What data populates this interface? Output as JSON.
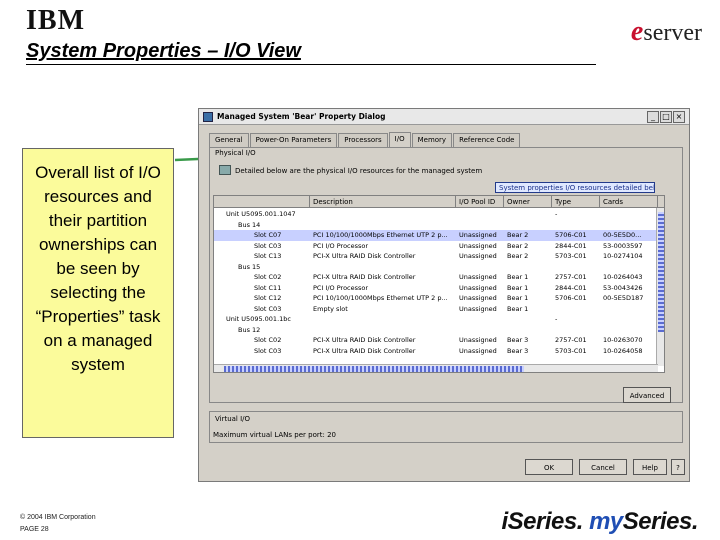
{
  "header": {
    "logo_text": "IBM",
    "brand_e": "e",
    "brand_rest": "server",
    "slide_title": "System Properties – I/O View"
  },
  "callout": {
    "text": "Overall list of I/O resources and their partition ownerships can be seen by selecting the “Properties” task on a managed system"
  },
  "dialog": {
    "title": "Managed System 'Bear' Property Dialog",
    "tabs": [
      "General",
      "Power-On Parameters",
      "Processors",
      "I/O",
      "Memory",
      "Reference Code"
    ],
    "active_tab": "I/O",
    "physical_io_label": "Physical I/O",
    "description": "Detailed below are the physical I/O resources for the managed system",
    "task_button": "System properties I/O resources detailed below",
    "columns": [
      "",
      "Description",
      "I/O Pool ID",
      "Owner",
      "Type",
      "Cards"
    ],
    "rows": [
      {
        "tree": "Unit U5095.001.1047",
        "desc": "",
        "pool": "",
        "owner": "",
        "type": "-",
        "cards": "",
        "selected": false
      },
      {
        "tree": "Bus 14",
        "desc": "",
        "pool": "",
        "owner": "",
        "type": "",
        "cards": "",
        "selected": false
      },
      {
        "tree": "Slot C07",
        "desc": "PCI 10/100/1000Mbps Ethernet UTP 2 p...",
        "pool": "Unassigned",
        "owner": "Bear 2",
        "type": "5706-C01",
        "cards": "00-5E5D0...",
        "selected": true
      },
      {
        "tree": "Slot C03",
        "desc": "PCI I/O Processor",
        "pool": "Unassigned",
        "owner": "Bear 2",
        "type": "2844-C01",
        "cards": "53-0003597",
        "selected": false
      },
      {
        "tree": "Slot C13",
        "desc": "PCI-X Ultra RAID Disk Controller",
        "pool": "Unassigned",
        "owner": "Bear 2",
        "type": "5703-C01",
        "cards": "10-0274104",
        "selected": false
      },
      {
        "tree": "Bus 15",
        "desc": "",
        "pool": "",
        "owner": "",
        "type": "",
        "cards": "",
        "selected": false
      },
      {
        "tree": "Slot C02",
        "desc": "PCI-X Ultra RAID Disk Controller",
        "pool": "Unassigned",
        "owner": "Bear 1",
        "type": "2757-C01",
        "cards": "10-0264043",
        "selected": false
      },
      {
        "tree": "Slot C11",
        "desc": "PCI I/O Processor",
        "pool": "Unassigned",
        "owner": "Bear 1",
        "type": "2844-C01",
        "cards": "53-0043426",
        "selected": false
      },
      {
        "tree": "Slot C12",
        "desc": "PCI 10/100/1000Mbps Ethernet UTP 2 p...",
        "pool": "Unassigned",
        "owner": "Bear 1",
        "type": "5706-C01",
        "cards": "00-5E5D187",
        "selected": false
      },
      {
        "tree": "Slot C03",
        "desc": "Empty slot",
        "pool": "Unassigned",
        "owner": "Bear 1",
        "type": "",
        "cards": "",
        "selected": false
      },
      {
        "tree": "Unit U5095.001.1bc",
        "desc": "",
        "pool": "",
        "owner": "",
        "type": "-",
        "cards": "",
        "selected": false
      },
      {
        "tree": "Bus 12",
        "desc": "",
        "pool": "",
        "owner": "",
        "type": "",
        "cards": "",
        "selected": false
      },
      {
        "tree": "Slot C02",
        "desc": "PCI-X Ultra RAID Disk Controller",
        "pool": "Unassigned",
        "owner": "Bear 3",
        "type": "2757-C01",
        "cards": "10-0263070",
        "selected": false
      },
      {
        "tree": "Slot C03",
        "desc": "PCI-X Ultra RAID Disk Controller",
        "pool": "Unassigned",
        "owner": "Bear 3",
        "type": "5703-C01",
        "cards": "10-0264058",
        "selected": false
      }
    ],
    "advanced_button": "Advanced",
    "virtual_io_label": "Virtual I/O",
    "virtual_io_text": "Maximum virtual LANs per port:  20",
    "ok_button": "OK",
    "cancel_button": "Cancel",
    "help_button": "Help",
    "help_q": "?"
  },
  "footer": {
    "copyright": "© 2004 IBM Corporation",
    "page": "PAGE 28",
    "tagline_1": "iSeries.",
    "tagline_2": "my",
    "tagline_3": "Series."
  },
  "colors": {
    "callout_bg": "#fbfb9b",
    "connector": "#3a9a4a",
    "selection": "#c8d0ff",
    "brand_red": "#c8102e",
    "brand_blue": "#1f4eb4"
  }
}
